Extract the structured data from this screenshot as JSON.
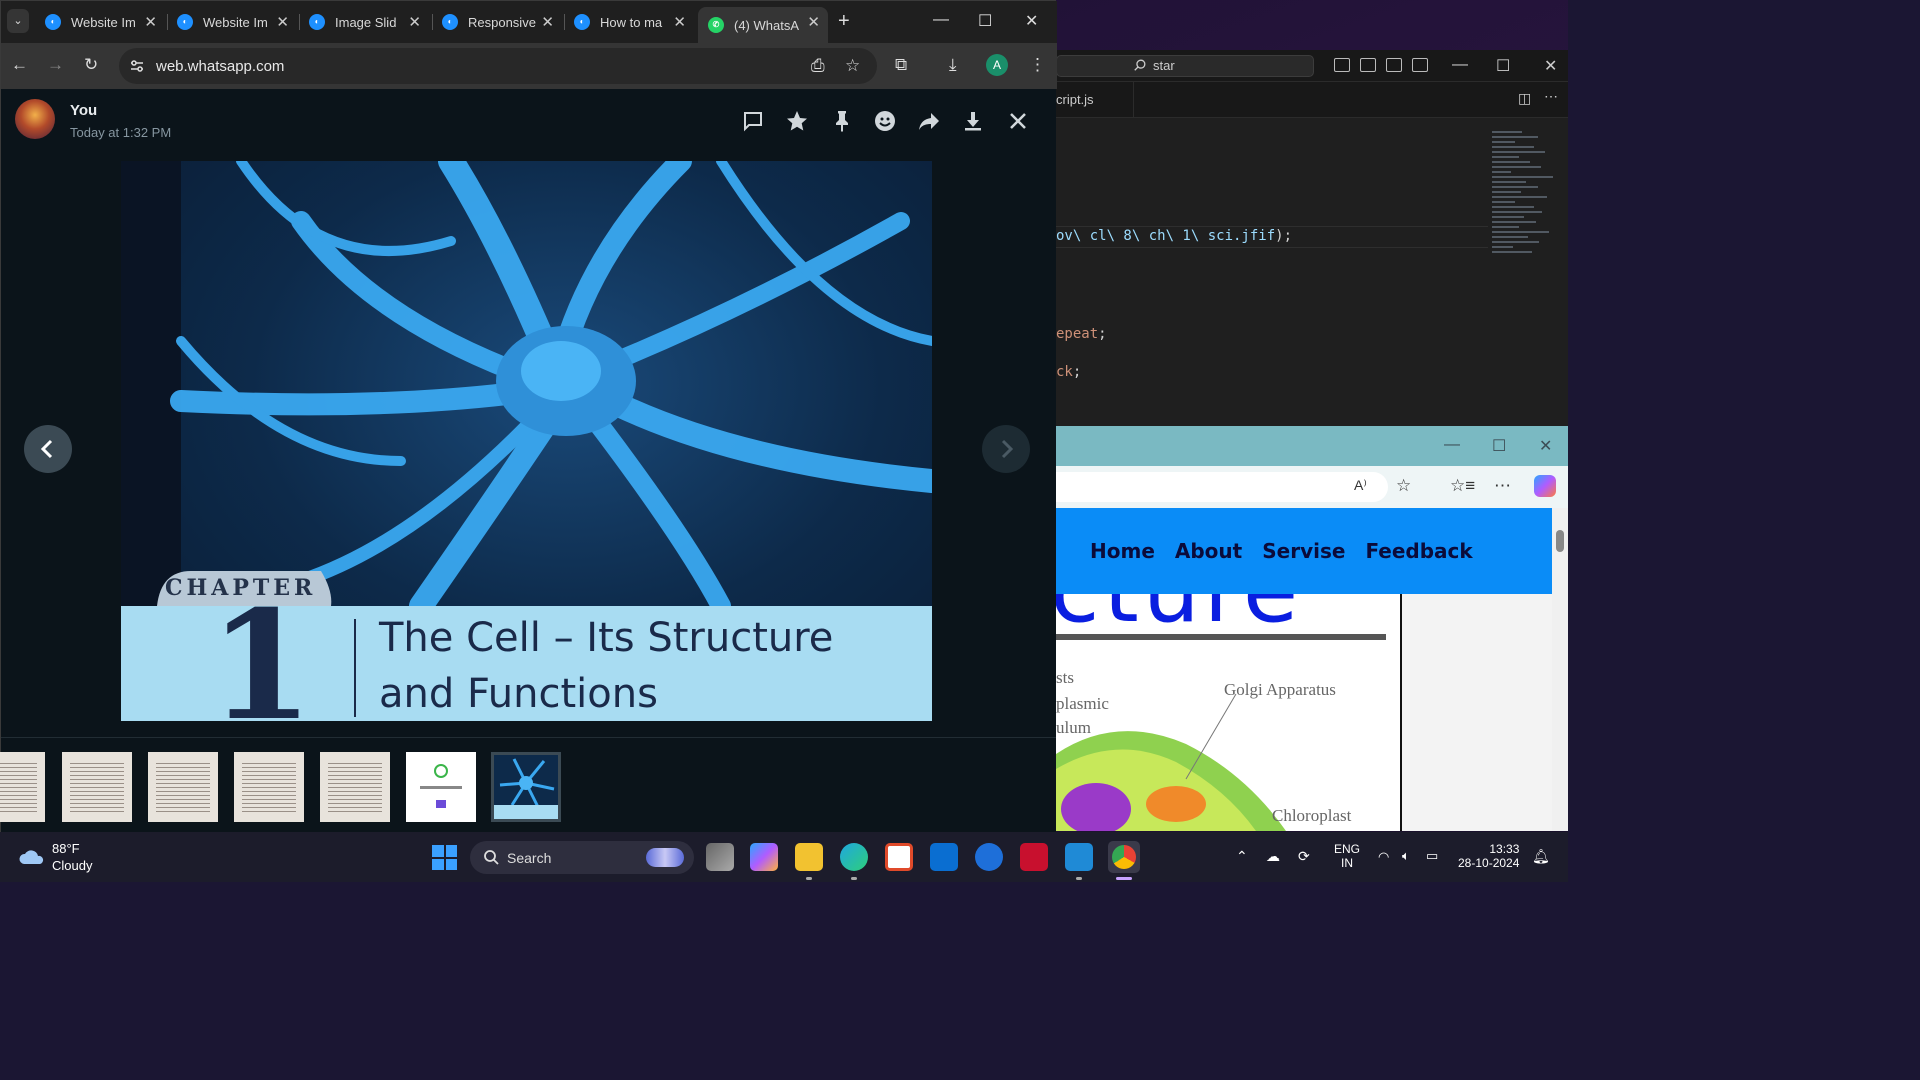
{
  "browser": {
    "tabs": [
      {
        "label": "Website Im",
        "favicon": "codecademy-icon",
        "active": false
      },
      {
        "label": "Website Im",
        "favicon": "codecademy-icon",
        "active": false
      },
      {
        "label": "Image Slid",
        "favicon": "codecademy-icon",
        "active": false
      },
      {
        "label": "Responsive",
        "favicon": "codecademy-icon",
        "active": false
      },
      {
        "label": "How to ma",
        "favicon": "codecademy-icon",
        "active": false
      },
      {
        "label": "(4) WhatsA",
        "favicon": "whatsapp-icon",
        "active": true
      }
    ],
    "url": "web.whatsapp.com",
    "profile_initial": "A"
  },
  "viewer": {
    "sender_name": "You",
    "sent_time": "Today at 1:32 PM",
    "image": {
      "chapter_label": "CHAPTER",
      "chapter_number": "1",
      "title_line1": "The Cell – Its Structure",
      "title_line2": "and Functions"
    },
    "thumbnail_count": 7,
    "selected_thumbnail_index": 6
  },
  "vscode": {
    "search": "star",
    "tab_label": "cript.js",
    "code_lines": [
      {
        "str": "ov\\ cl\\ 8\\ ch\\ 1\\ sci.jfif",
        "tail": ");"
      },
      {
        "kw": "epeat",
        "tail": ";"
      },
      {
        "kw": "ck",
        "tail": ";"
      }
    ]
  },
  "edge_site": {
    "nav": [
      "Home",
      "About",
      "Servise",
      "Feedback"
    ],
    "headline_fragment": "cture",
    "diagram_labels": [
      "Golgi Apparatus",
      "Chloroplast",
      "sts",
      "plasmic",
      "ulum"
    ]
  },
  "taskbar": {
    "weather_temp": "88°F",
    "weather_desc": "Cloudy",
    "search_label": "Search",
    "lang_top": "ENG",
    "lang_bottom": "IN",
    "time": "13:33",
    "date": "28-10-2024"
  },
  "colors": {
    "whatsapp_bg": "#0b141a",
    "chrome_tabstrip": "#1f1f1f",
    "site_nav_blue": "#0a8cf7",
    "taskbar": "#1c1c2b"
  }
}
